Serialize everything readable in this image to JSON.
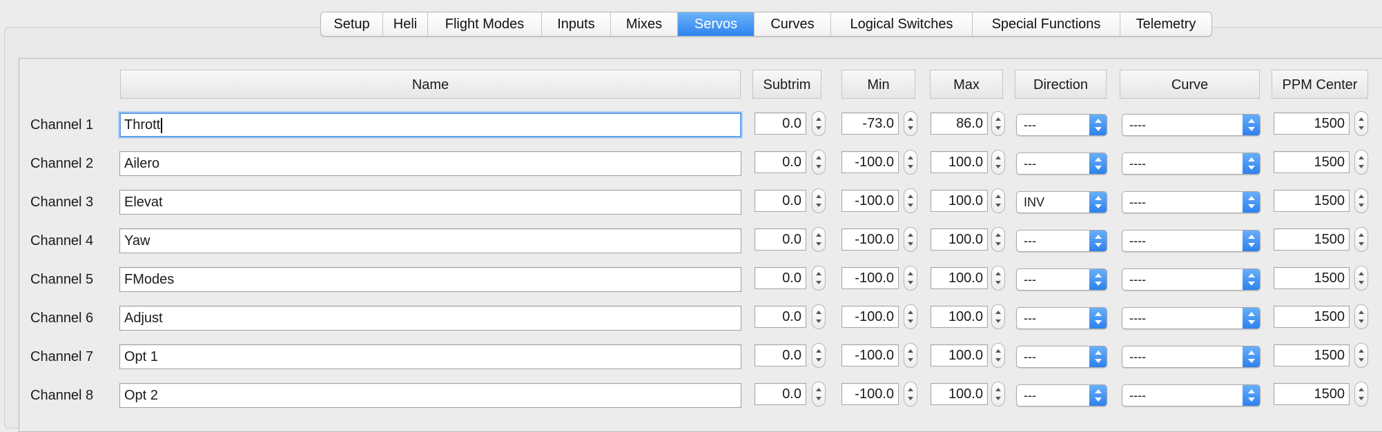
{
  "tabs": [
    {
      "label": "Setup",
      "active": false
    },
    {
      "label": "Heli",
      "active": false
    },
    {
      "label": "Flight Modes",
      "active": false
    },
    {
      "label": "Inputs",
      "active": false
    },
    {
      "label": "Mixes",
      "active": false
    },
    {
      "label": "Servos",
      "active": true
    },
    {
      "label": "Curves",
      "active": false
    },
    {
      "label": "Logical Switches",
      "active": false
    },
    {
      "label": "Special Functions",
      "active": false
    },
    {
      "label": "Telemetry",
      "active": false
    }
  ],
  "columns": {
    "name": "Name",
    "subtrim": "Subtrim",
    "min": "Min",
    "max": "Max",
    "direction": "Direction",
    "curve": "Curve",
    "ppm_center": "PPM Center"
  },
  "channels": [
    {
      "label": "Channel 1",
      "name": "Thrott",
      "subtrim": "0.0",
      "min": "-73.0",
      "max": "86.0",
      "direction": "---",
      "curve": "----",
      "ppm": "1500",
      "focused": true
    },
    {
      "label": "Channel 2",
      "name": "Ailero",
      "subtrim": "0.0",
      "min": "-100.0",
      "max": "100.0",
      "direction": "---",
      "curve": "----",
      "ppm": "1500"
    },
    {
      "label": "Channel 3",
      "name": "Elevat",
      "subtrim": "0.0",
      "min": "-100.0",
      "max": "100.0",
      "direction": "INV",
      "curve": "----",
      "ppm": "1500"
    },
    {
      "label": "Channel 4",
      "name": "Yaw",
      "subtrim": "0.0",
      "min": "-100.0",
      "max": "100.0",
      "direction": "---",
      "curve": "----",
      "ppm": "1500"
    },
    {
      "label": "Channel 5",
      "name": "FModes",
      "subtrim": "0.0",
      "min": "-100.0",
      "max": "100.0",
      "direction": "---",
      "curve": "----",
      "ppm": "1500"
    },
    {
      "label": "Channel 6",
      "name": "Adjust",
      "subtrim": "0.0",
      "min": "-100.0",
      "max": "100.0",
      "direction": "---",
      "curve": "----",
      "ppm": "1500"
    },
    {
      "label": "Channel 7",
      "name": "Opt 1",
      "subtrim": "0.0",
      "min": "-100.0",
      "max": "100.0",
      "direction": "---",
      "curve": "----",
      "ppm": "1500"
    },
    {
      "label": "Channel 8",
      "name": "Opt 2",
      "subtrim": "0.0",
      "min": "-100.0",
      "max": "100.0",
      "direction": "---",
      "curve": "----",
      "ppm": "1500"
    }
  ],
  "colors": {
    "accent": "#2d84ee",
    "background": "#ececec"
  }
}
